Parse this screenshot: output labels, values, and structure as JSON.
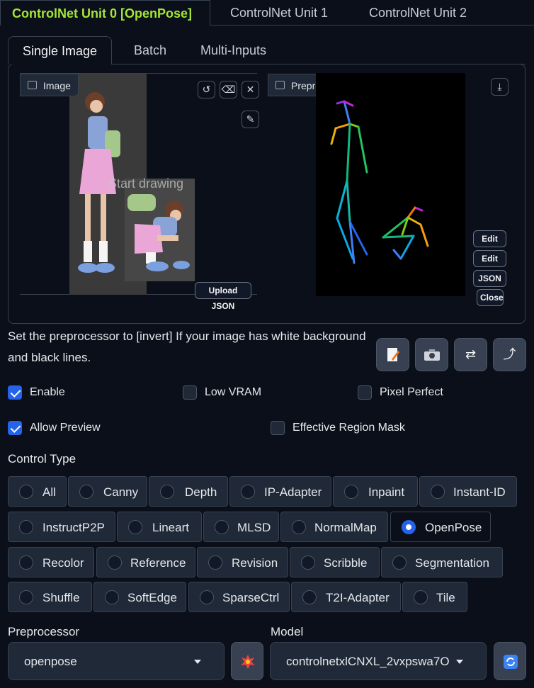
{
  "units": [
    "ControlNet Unit 0 [OpenPose]",
    "ControlNet Unit 1",
    "ControlNet Unit 2"
  ],
  "input_tabs": [
    "Single Image",
    "Batch",
    "Multi-Inputs"
  ],
  "image_panel": {
    "label": "Image",
    "overlay_text": "Start drawing",
    "upload_json": "Upload JSON"
  },
  "preview_panel": {
    "label": "Preprocessor Preview",
    "buttons": [
      "Edit",
      "Edit",
      "JSON",
      "Close"
    ]
  },
  "hint": "Set the preprocessor to [invert] If your image has white background and black lines.",
  "tool_icons": [
    "document-edit-icon",
    "camera-icon",
    "swap-icon",
    "send-dimensions-icon"
  ],
  "options": {
    "enable": {
      "label": "Enable",
      "checked": true
    },
    "low_vram": {
      "label": "Low VRAM",
      "checked": false
    },
    "pixel_perfect": {
      "label": "Pixel Perfect",
      "checked": false
    },
    "allow_preview": {
      "label": "Allow Preview",
      "checked": true
    },
    "effective_region_mask": {
      "label": "Effective Region Mask",
      "checked": false
    }
  },
  "control_type": {
    "label": "Control Type",
    "selected": "OpenPose",
    "rows": [
      [
        "All",
        "Canny",
        "Depth",
        "IP-Adapter",
        "Inpaint",
        "Instant-ID"
      ],
      [
        "InstructP2P",
        "Lineart",
        "MLSD",
        "NormalMap",
        "OpenPose"
      ],
      [
        "Recolor",
        "Reference",
        "Revision",
        "Scribble",
        "Segmentation"
      ],
      [
        "Shuffle",
        "SoftEdge",
        "SparseCtrl",
        "T2I-Adapter",
        "Tile"
      ]
    ]
  },
  "preprocessor": {
    "label": "Preprocessor",
    "value": "openpose"
  },
  "model": {
    "label": "Model",
    "value": "controlnetxlCNXL_2vxpswa7O"
  }
}
